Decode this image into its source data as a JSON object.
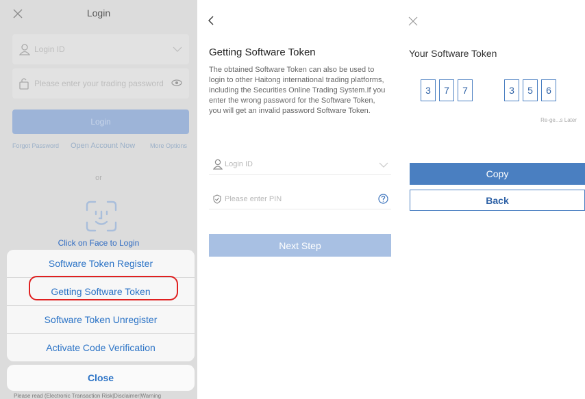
{
  "login_screen": {
    "title": "Login",
    "login_id_placeholder": "Login ID",
    "password_placeholder": "Please enter your trading password",
    "login_button": "Login",
    "forgot_password": "Forgot Password",
    "open_account": "Open Account Now",
    "more_options": "More Options",
    "or_label": "or",
    "face_login_label": "Click on Face to Login",
    "footer_text": "Please read (Electronic Transaction Risk|Disclaimer|Warning",
    "sheet_items": [
      "Software Token Register",
      "Getting Software Token",
      "Software Token Unregister",
      "Activate Code Verification"
    ],
    "close_label": "Close"
  },
  "getting_token": {
    "title": "Getting Software Token",
    "description": "The obtained Software Token can also be used to login to other Haitong international trading platforms, including the Securities Online Trading System.If you enter the wrong password for the Software Token, you will get an invalid password Software Token.",
    "login_id_placeholder": "Login ID",
    "pin_placeholder": "Please enter PIN",
    "next_button": "Next Step"
  },
  "your_token": {
    "title": "Your Software Token",
    "digits": [
      "3",
      "7",
      "7",
      "3",
      "5",
      "6"
    ],
    "regenerate_note": "Re-ge...s Later",
    "copy_button": "Copy",
    "back_button": "Back"
  },
  "colors": {
    "accent": "#4a7fc1",
    "highlight": "#e02020",
    "link": "#2b73c6"
  }
}
